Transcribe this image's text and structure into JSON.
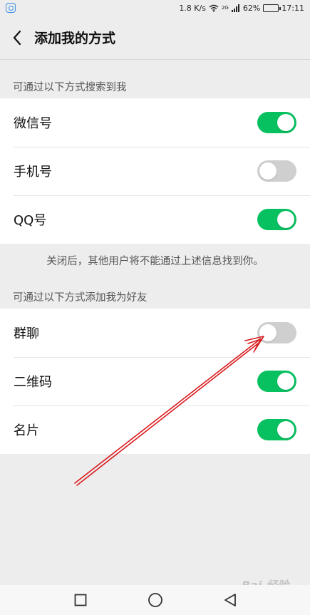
{
  "status_bar": {
    "speed": "1.8 K/s",
    "network": "2G",
    "battery_percent": "62%",
    "battery_level": 0.62,
    "time": "17:11"
  },
  "header": {
    "title": "添加我的方式"
  },
  "search_section": {
    "label": "可通过以下方式搜索到我",
    "items": [
      {
        "label": "微信号",
        "enabled": true
      },
      {
        "label": "手机号",
        "enabled": false
      },
      {
        "label": "QQ号",
        "enabled": true
      }
    ],
    "hint": "关闭后，其他用户将不能通过上述信息找到你。"
  },
  "add_section": {
    "label": "可通过以下方式添加我为好友",
    "items": [
      {
        "label": "群聊",
        "enabled": false
      },
      {
        "label": "二维码",
        "enabled": true
      },
      {
        "label": "名片",
        "enabled": true
      }
    ]
  },
  "colors": {
    "toggle_on": "#07c160",
    "toggle_off": "#cfcfcf",
    "background": "#ededed",
    "annotation_arrow": "#d9191c"
  },
  "watermark": "Bai 经验"
}
